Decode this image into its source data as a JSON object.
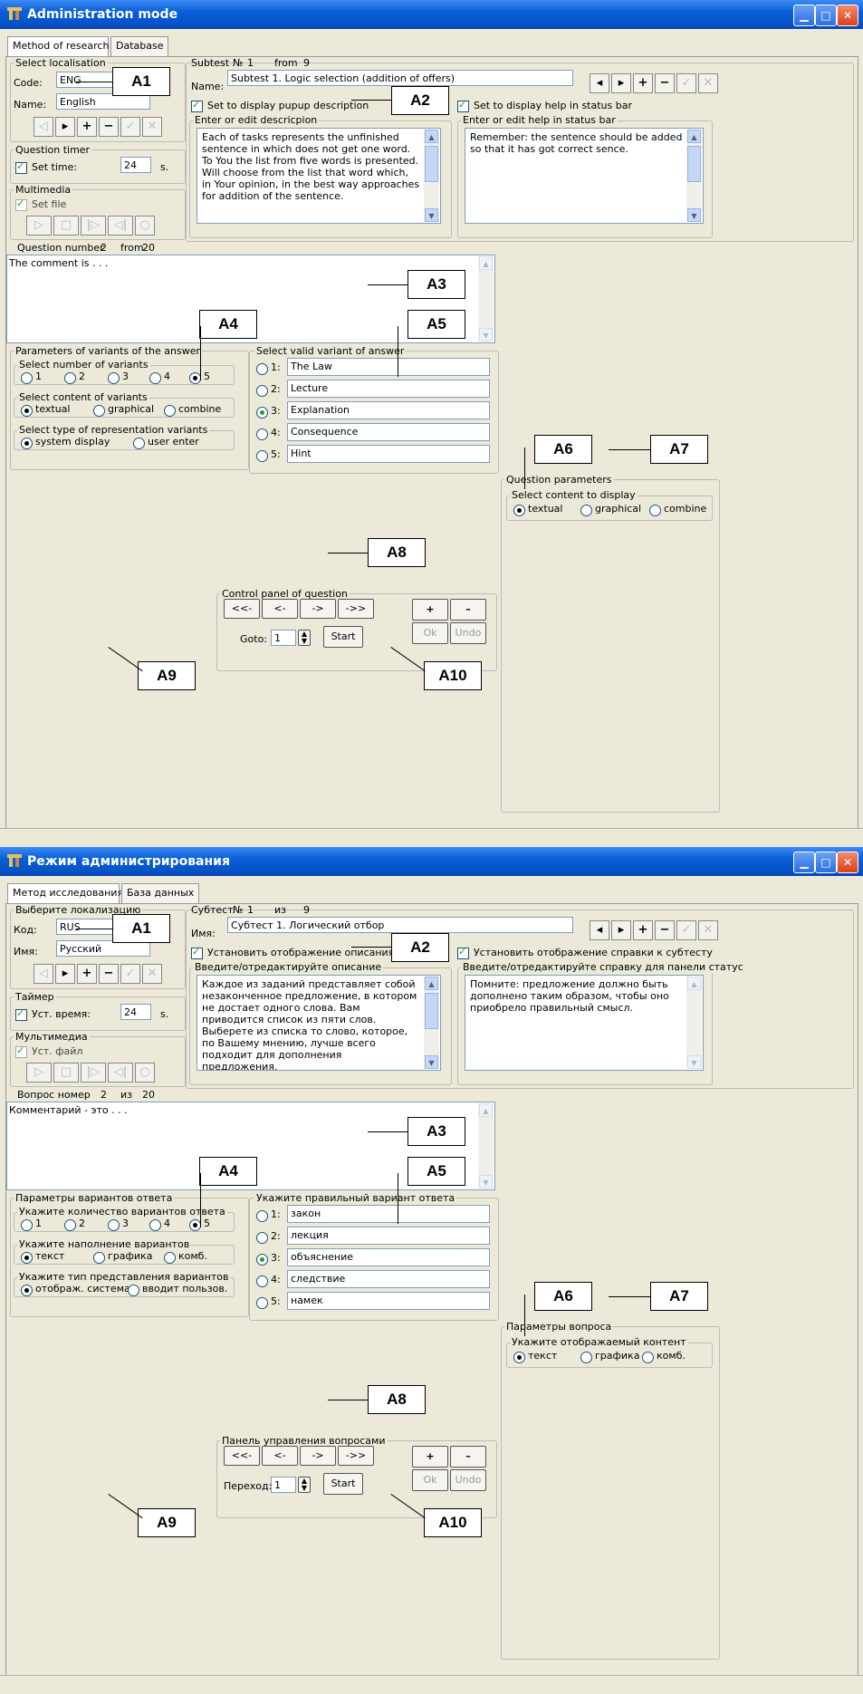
{
  "windows": [
    {
      "title": "Administration mode",
      "tabs": [
        "Method of research",
        "Database"
      ],
      "localisation": {
        "group": "Select localisation",
        "code_label": "Code:",
        "code_value": "ENG",
        "name_label": "Name:",
        "name_value": "English"
      },
      "timer": {
        "group": "Question timer",
        "checkbox_label": "Set time:",
        "value": "24",
        "unit": "s."
      },
      "multimedia": {
        "group": "Multimedia",
        "checkbox_label": "Set file"
      },
      "question_number": {
        "label": "Question number",
        "value": "2",
        "from_label": "from",
        "total": "20"
      },
      "comment_text": "The comment is . . .",
      "subtest": {
        "label": "Subtest",
        "no_label": "№",
        "no_value": "1",
        "from_label": "from",
        "total": "9",
        "name_label": "Name:",
        "name_value": "Subtest 1. Logic selection (addition of offers)"
      },
      "popup": {
        "checkbox_label": "Set to display pupup description",
        "group": "Enter or edit descricpion",
        "text": "Each of tasks represents the unfinished sentence in which does not get one word. To You the list from five words is presented. Will choose from the list that word which, in Your opinion, in the best way approaches for addition of the sentence."
      },
      "help": {
        "checkbox_label": "Set to display help in status bar",
        "group": "Enter or edit help in status bar",
        "text": "Remember: the sentence should be added so that it has got correct sence."
      },
      "params": {
        "group": "Parameters of variants of the answer",
        "count_group": "Select number of variants",
        "counts": [
          "1",
          "2",
          "3",
          "4",
          "5"
        ],
        "content_group": "Select content of variants",
        "content_options": [
          "textual",
          "graphical",
          "combine"
        ],
        "rep_group": "Select type of representation variants",
        "rep_options": [
          "system display",
          "user enter"
        ]
      },
      "valid": {
        "group": "Select valid variant of answer",
        "items": [
          {
            "num": "1:",
            "value": "The Law"
          },
          {
            "num": "2:",
            "value": "Lecture"
          },
          {
            "num": "3:",
            "value": "Explanation"
          },
          {
            "num": "4:",
            "value": "Consequence"
          },
          {
            "num": "5:",
            "value": "Hint"
          }
        ]
      },
      "qparams": {
        "group": "Question parameters",
        "sub_group": "Select content to display",
        "options": [
          "textual",
          "graphical",
          "combine"
        ]
      },
      "control": {
        "group": "Control panel of question",
        "first": "<<-",
        "prev": "<-",
        "next": "->",
        "last": "->>",
        "goto_label": "Goto:",
        "goto_value": "1",
        "start": "Start",
        "plus": "+",
        "minus": "–",
        "ok": "Ok",
        "undo": "Undo"
      }
    },
    {
      "title": "Режим администрирования",
      "tabs": [
        "Метод исследования",
        "База данных"
      ],
      "localisation": {
        "group": "Выберите локализацию",
        "code_label": "Код:",
        "code_value": "RUS",
        "name_label": "Имя:",
        "name_value": "Русский"
      },
      "timer": {
        "group": "Таймер",
        "checkbox_label": "Уст. время:",
        "value": "24",
        "unit": "s."
      },
      "multimedia": {
        "group": "Мультимедиа",
        "checkbox_label": "Уст. файл"
      },
      "question_number": {
        "label": "Вопрос номер",
        "value": "2",
        "from_label": "из",
        "total": "20"
      },
      "comment_text": "Комментарий - это . . .",
      "subtest": {
        "label": "Субтест",
        "no_label": "№",
        "no_value": "1",
        "from_label": "из",
        "total": "9",
        "name_label": "Имя:",
        "name_value": "Субтест 1. Логический отбор"
      },
      "popup": {
        "checkbox_label": "Установить отображение описания субтеста",
        "group": "Введите/отредактируйте описание",
        "text": "Каждое  из заданий представляет собой незаконченное предложение, в котором не достает одного слова. Вам приводится список из пяти слов. Выберете из списка то слово, которое, по Вашему мнению, лучше всего подходит для дополнения предложения."
      },
      "help": {
        "checkbox_label": "Установить отображение справки к субтесту",
        "group": "Введите/отредактируйте справку для панели статус",
        "text": "Помните: предложение должно быть дополнено таким образом, чтобы оно приобрело правильный смысл."
      },
      "params": {
        "group": "Параметры вариантов ответа",
        "count_group": "Укажите количество вариантов ответа",
        "counts": [
          "1",
          "2",
          "3",
          "4",
          "5"
        ],
        "content_group": "Укажите наполнение вариантов",
        "content_options": [
          "текст",
          "графика",
          "комб."
        ],
        "rep_group": "Укажите тип представления вариантов",
        "rep_options": [
          "отображ. система",
          "вводит пользов."
        ]
      },
      "valid": {
        "group": "Укажите правильный вариант ответа",
        "items": [
          {
            "num": "1:",
            "value": "закон"
          },
          {
            "num": "2:",
            "value": "лекция"
          },
          {
            "num": "3:",
            "value": "объяснение"
          },
          {
            "num": "4:",
            "value": "следствие"
          },
          {
            "num": "5:",
            "value": "намек"
          }
        ]
      },
      "qparams": {
        "group": "Параметры вопроса",
        "sub_group": "Укажите отображаемый контент",
        "options": [
          "текст",
          "графика",
          "комб."
        ]
      },
      "control": {
        "group": "Панель управления вопросами",
        "first": "<<-",
        "prev": "<-",
        "next": "->",
        "last": "->>",
        "goto_label": "Переход:",
        "goto_value": "1",
        "start": "Start",
        "plus": "+",
        "minus": "–",
        "ok": "Ok",
        "undo": "Undo"
      }
    }
  ],
  "annotations": [
    "A1",
    "A2",
    "A3",
    "A4",
    "A5",
    "A6",
    "A7",
    "A8",
    "A9",
    "A10"
  ],
  "icons": {
    "app": "app-icon",
    "minimize": "minimize-icon",
    "maximize": "maximize-icon",
    "close": "close-icon",
    "nav_first": "nav-first-icon",
    "nav_next": "nav-next-icon",
    "nav_add": "plus-icon",
    "nav_remove": "minus-icon",
    "nav_accept": "check-icon",
    "nav_cancel": "cancel-icon",
    "media_play": "play-icon",
    "media_stop": "stop-icon",
    "media_step": "step-icon",
    "media_back": "rewind-icon",
    "media_circle": "circle-icon"
  },
  "colors": {
    "titlebar": "#0553c9",
    "window_bg": "#ece9d8",
    "radio_check": "#21a121"
  }
}
